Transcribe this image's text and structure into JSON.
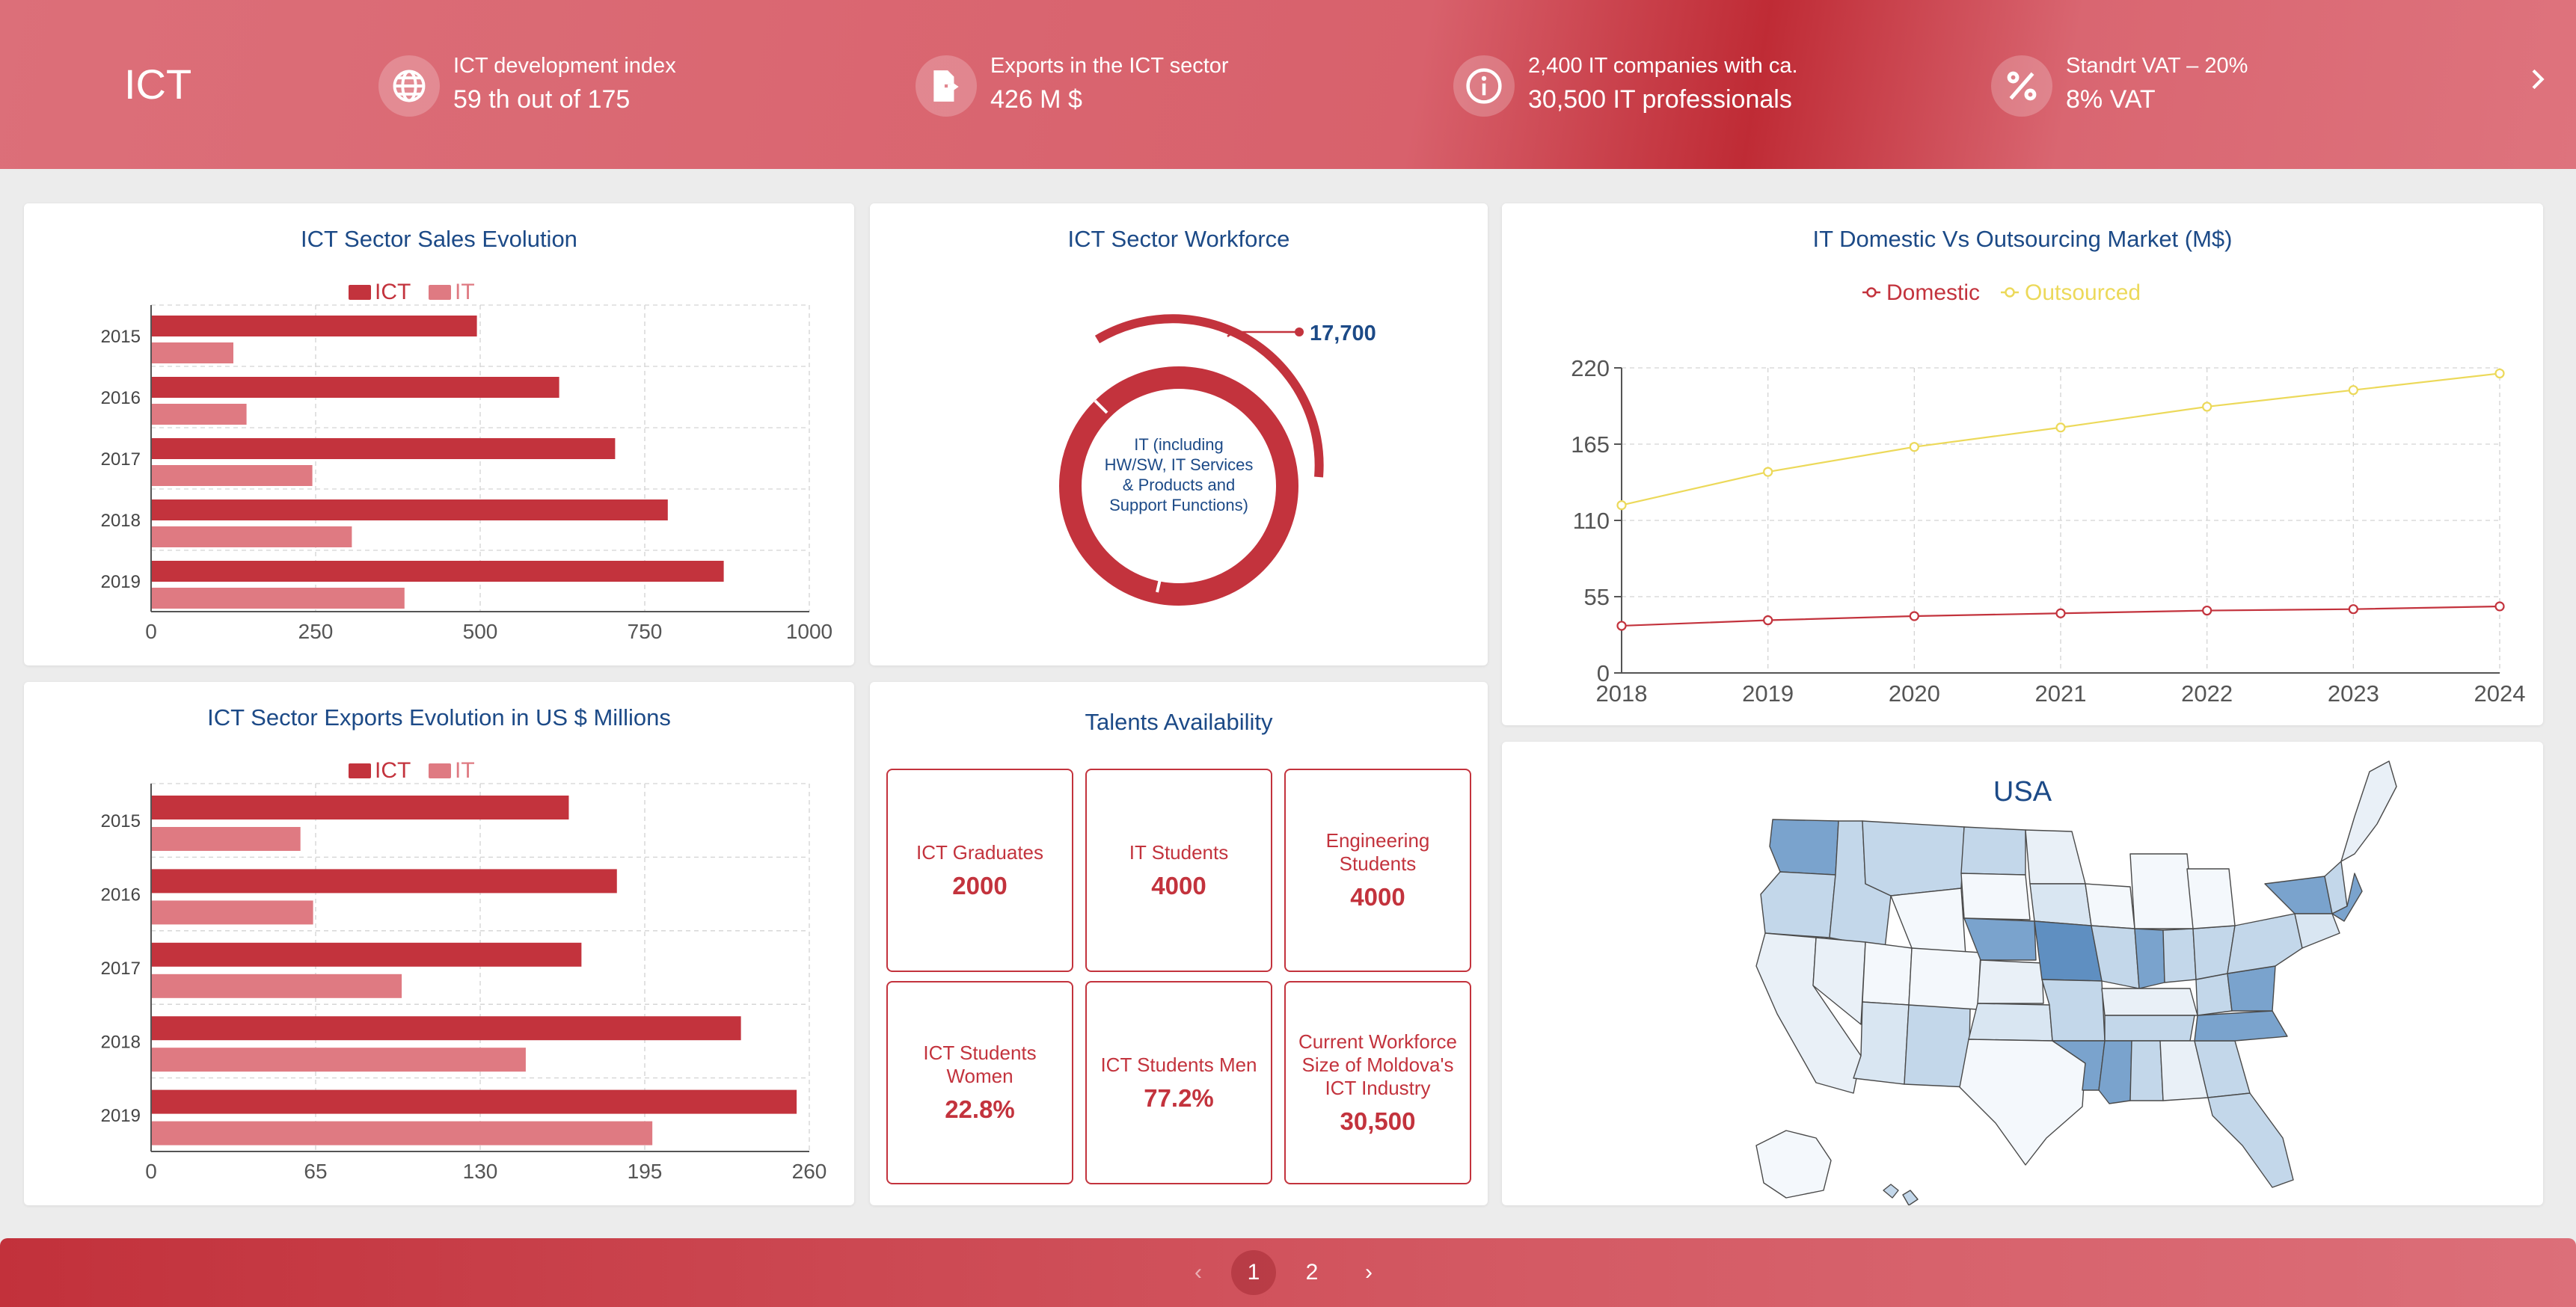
{
  "header": {
    "title": "ICT",
    "kpis": [
      {
        "icon": "globe-icon",
        "label": "ICT development index",
        "value": "59 th out of 175"
      },
      {
        "icon": "file-export-icon",
        "label": "Exports in the ICT sector",
        "value": "426 M $"
      },
      {
        "icon": "info-icon",
        "label": "2,400 IT companies with ca.",
        "value": "30,500 IT professionals"
      },
      {
        "icon": "percent-icon",
        "label": "Standrt VAT – 20%",
        "value": "8% VAT"
      }
    ]
  },
  "colors": {
    "primary": "#c3333d",
    "secondary": "#df7a82",
    "title": "#1c4a87",
    "outsourced": "#ecd95a"
  },
  "sales_chart": {
    "title": "ICT Sector Sales Evolution",
    "legend": [
      "ICT",
      "IT"
    ]
  },
  "exports_chart": {
    "title": "ICT Sector Exports Evolution in US $ Millions",
    "legend": [
      "ICT",
      "IT"
    ]
  },
  "workforce": {
    "title": "ICT Sector Workforce",
    "center_label": [
      "IT (including",
      "HW/SW, IT Services",
      "& Products and",
      "Support Functions)"
    ],
    "callout_value": "17,700"
  },
  "market_chart": {
    "title": "IT Domestic Vs Outsourcing Market (M$)",
    "legend": [
      "Domestic",
      "Outsourced"
    ]
  },
  "talents": {
    "title": "Talents Availability",
    "tiles": [
      {
        "label": "ICT Graduates",
        "value": "2000"
      },
      {
        "label": "IT Students",
        "value": "4000"
      },
      {
        "label": "Engineering Students",
        "value": "4000"
      },
      {
        "label": "ICT Students Women",
        "value": "22.8%"
      },
      {
        "label": "ICT Students Men",
        "value": "77.2%"
      },
      {
        "label": "Current Workforce Size of Moldova's ICT Industry",
        "value": "30,500"
      }
    ]
  },
  "map": {
    "title": "USA"
  },
  "pagination": {
    "prev": "‹",
    "pages": [
      "1",
      "2"
    ],
    "active": "1",
    "next": "›"
  },
  "chart_data": [
    {
      "type": "bar",
      "orientation": "horizontal",
      "title": "ICT Sector Sales Evolution",
      "categories": [
        "2015",
        "2016",
        "2017",
        "2018",
        "2019"
      ],
      "series": [
        {
          "name": "ICT",
          "values": [
            495,
            620,
            705,
            785,
            870
          ]
        },
        {
          "name": "IT",
          "values": [
            125,
            145,
            245,
            305,
            385
          ]
        }
      ],
      "xlim": [
        0,
        1000
      ],
      "xticks": [
        "0",
        "250",
        "500",
        "750",
        "1000"
      ]
    },
    {
      "type": "bar",
      "orientation": "horizontal",
      "title": "ICT Sector Exports Evolution in US $ Millions",
      "categories": [
        "2015",
        "2016",
        "2017",
        "2018",
        "2019"
      ],
      "series": [
        {
          "name": "ICT",
          "values": [
            165,
            184,
            170,
            233,
            255
          ]
        },
        {
          "name": "IT",
          "values": [
            59,
            64,
            99,
            148,
            198
          ]
        }
      ],
      "xlim": [
        0,
        260
      ],
      "xticks": [
        "0",
        "65",
        "130",
        "195",
        "260"
      ]
    },
    {
      "type": "line",
      "title": "IT Domestic Vs Outsourcing Market (M$)",
      "x": [
        "2018",
        "2019",
        "2020",
        "2021",
        "2022",
        "2023",
        "2024"
      ],
      "series": [
        {
          "name": "Domestic",
          "values": [
            34,
            38,
            41,
            43,
            45,
            46,
            48
          ]
        },
        {
          "name": "Outsourced",
          "values": [
            121,
            145,
            163,
            177,
            192,
            204,
            216
          ]
        }
      ],
      "ylim": [
        0,
        220
      ],
      "yticks": [
        "0",
        "55",
        "110",
        "165",
        "220"
      ]
    },
    {
      "type": "pie",
      "variant": "donut",
      "title": "ICT Sector Workforce",
      "labels": [
        "IT (including HW/SW, IT Services & Products and Support Functions)"
      ],
      "values": [
        17700
      ]
    }
  ]
}
